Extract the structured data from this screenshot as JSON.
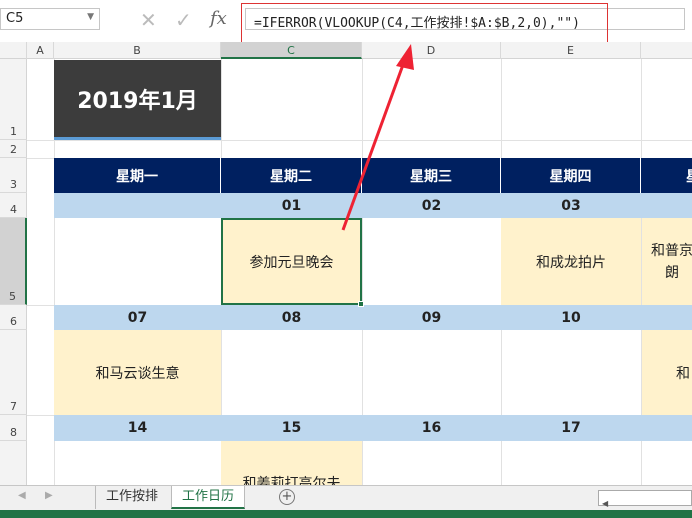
{
  "formula_bar": {
    "name_box": "C5",
    "cancel_icon": "✕",
    "enter_icon": "✓",
    "fx_label": "fx",
    "formula": "=IFERROR(VLOOKUP(C4,工作按排!$A:$B,2,0),\"\")"
  },
  "columns": [
    "A",
    "B",
    "C",
    "D",
    "E"
  ],
  "rows": [
    "1",
    "2",
    "3",
    "4",
    "5",
    "6",
    "7",
    "8"
  ],
  "title": "2019年1月",
  "weekdays": [
    "星期一",
    "星期二",
    "星期三",
    "星期四",
    "星"
  ],
  "week1": {
    "dates": [
      "",
      "01",
      "02",
      "03",
      ""
    ],
    "events": [
      "",
      "参加元旦晚会",
      "",
      "和成龙拍片",
      "和普京\n朗"
    ]
  },
  "week2": {
    "dates": [
      "07",
      "08",
      "09",
      "10",
      ""
    ],
    "events": [
      "和马云谈生意",
      "",
      "",
      "",
      "和"
    ]
  },
  "week3": {
    "dates": [
      "14",
      "15",
      "16",
      "17",
      ""
    ],
    "events": [
      "",
      "和姜莉打高尔夫",
      "",
      "",
      ""
    ]
  },
  "sheet_tabs": [
    "工作按排",
    "工作日历"
  ],
  "add_sheet": "+",
  "colors": {
    "header": "#002060",
    "date_row": "#bdd7ee",
    "event": "#fff2cc",
    "title_bg": "#3c3c3c",
    "excel_green": "#217346",
    "annotation": "#dd3333"
  }
}
